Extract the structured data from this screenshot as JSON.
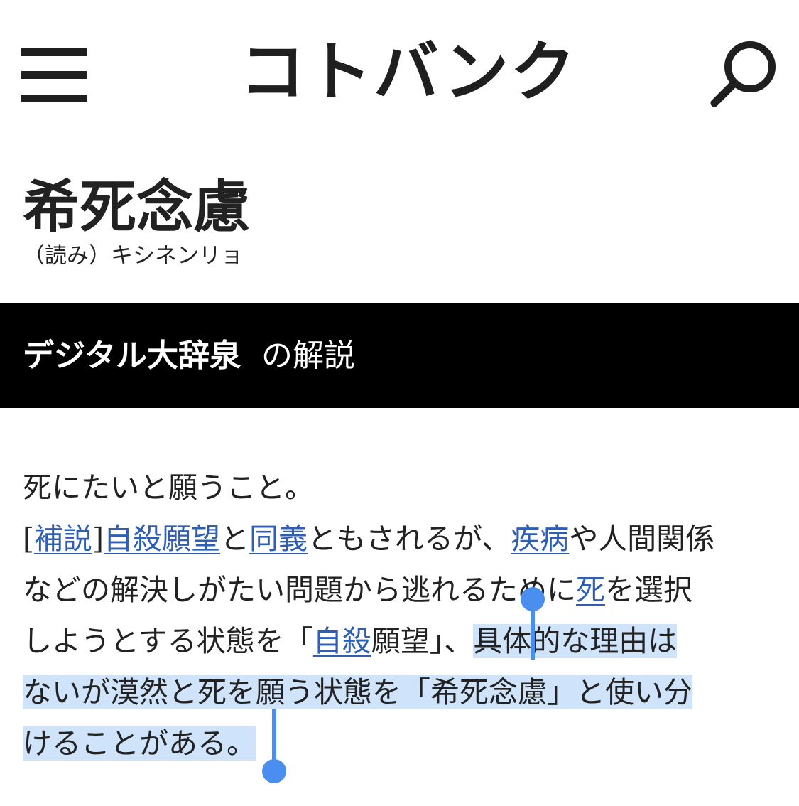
{
  "header": {
    "logo": "コトバンク",
    "menu_icon": "hamburger-menu-icon",
    "search_icon": "search-icon"
  },
  "entry": {
    "title": "希死念慮",
    "reading": "（読み）キシネンリョ"
  },
  "section": {
    "source": "デジタル大辞泉",
    "suffix": "の解説"
  },
  "body": {
    "line1": "死にたいと願うこと。",
    "line2": {
      "bracket_open": "[",
      "hosetsu": "補説",
      "bracket_close": "]",
      "link_jisatsu_ganbou": "自殺願望",
      "t1": "と",
      "link_dougi": "同義",
      "t2": "ともされるが、",
      "link_shippei": "疾病",
      "t3": "や人間関係"
    },
    "line3": {
      "t1": "などの解決しがたい問題から逃れるために",
      "link_shi": "死",
      "t2": "を選択"
    },
    "line4": {
      "t1": "しようとする状態を「",
      "link_jisatsu": "自殺",
      "t2": "願望」、",
      "t3_selected": "具体的な理由は"
    },
    "line5_selected": "ないが漠然と死を願う状態を「希死念慮」と使い分",
    "line6_selected": "けることがある。"
  },
  "colors": {
    "link": "#2f5fb4",
    "selection": "#cfe3fb",
    "handle": "#4a8ff0",
    "section_bar": "#000000"
  }
}
